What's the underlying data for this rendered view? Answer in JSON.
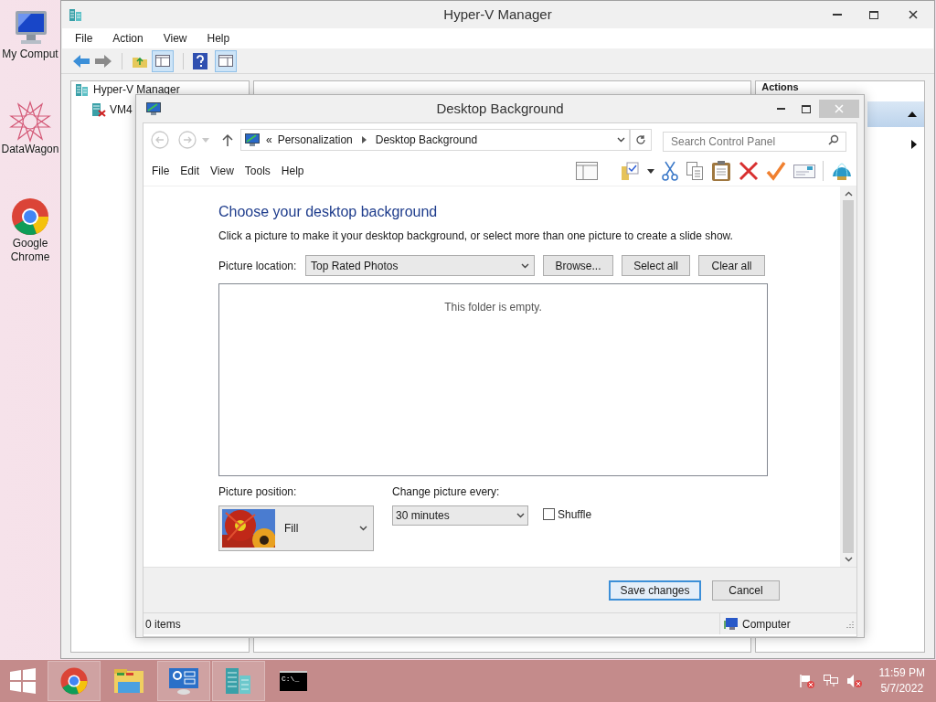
{
  "desktop_icons": [
    {
      "kind": "computer",
      "label": "My Comput"
    },
    {
      "kind": "datawagon",
      "label": "DataWagon"
    },
    {
      "kind": "chrome",
      "label": "Google Chrome"
    }
  ],
  "hyperv": {
    "title": "Hyper-V Manager",
    "menu": [
      "File",
      "Action",
      "View",
      "Help"
    ],
    "tree": [
      {
        "label": "Hyper-V Manager",
        "children": [
          {
            "label": "VM4"
          }
        ]
      }
    ],
    "actions_title": "Actions"
  },
  "dialog": {
    "title": "Desktop Background",
    "breadcrumb_prefix": "«",
    "breadcrumb": [
      "Personalization",
      "Desktop Background"
    ],
    "search": {
      "placeholder": "Search Control Panel"
    },
    "menu": [
      "File",
      "Edit",
      "View",
      "Tools",
      "Help"
    ],
    "heading": "Choose your desktop background",
    "description": "Click a picture to make it your desktop background, or select more than one picture to create a slide show.",
    "picture_location": {
      "label": "Picture location:",
      "value": "Top Rated Photos"
    },
    "location_buttons": [
      "Browse...",
      "Select all",
      "Clear all"
    ],
    "empty_message": "This folder is empty.",
    "picture_position": {
      "label": "Picture position:",
      "value": "Fill"
    },
    "change_every": {
      "label": "Change picture every:",
      "value": "30 minutes"
    },
    "shuffle": {
      "label": "Shuffle",
      "checked": false
    },
    "footer_buttons": [
      {
        "label": "Save changes",
        "default": true
      },
      {
        "label": "Cancel",
        "default": false
      }
    ],
    "status": {
      "items": "0 items",
      "zone": "Computer"
    }
  },
  "taskbar": {
    "apps": [
      {
        "kind": "chrome",
        "running": true
      },
      {
        "kind": "explorer",
        "running": false
      },
      {
        "kind": "control-panel",
        "running": true
      },
      {
        "kind": "servers",
        "running": true
      },
      {
        "kind": "cmd",
        "running": false,
        "glyph": "C:\\_"
      }
    ],
    "clock": {
      "time": "11:59 PM",
      "date": "5/7/2022"
    }
  }
}
